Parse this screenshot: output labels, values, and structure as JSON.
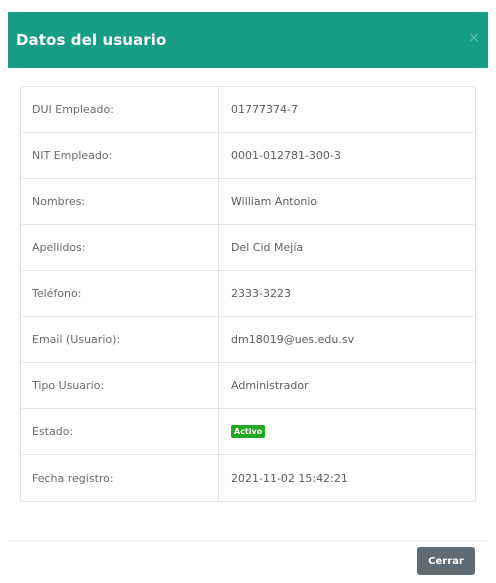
{
  "modal": {
    "title": "Datos del usuario",
    "close_icon": "×",
    "fields": [
      {
        "label": "DUI Empleado:",
        "value": "01777374-7"
      },
      {
        "label": "NIT Empleado:",
        "value": "0001-012781-300-3"
      },
      {
        "label": "Nombres:",
        "value": "William Antonio"
      },
      {
        "label": "Apellidos:",
        "value": "Del Cid Mejía"
      },
      {
        "label": "Teléfono:",
        "value": "2333-3223"
      },
      {
        "label": "Email (Usuario):",
        "value": "dm18019@ues.edu.sv"
      },
      {
        "label": "Tipo Usuario:",
        "value": "Administrador"
      },
      {
        "label": "Estado:",
        "value": "Activo"
      },
      {
        "label": "Fecha registro:",
        "value": "2021-11-02 15:42:21"
      }
    ],
    "close_button_label": "Cerrar",
    "colors": {
      "header": "#169d84",
      "status_badge": "#22a722",
      "close_button": "#5f6b75"
    }
  }
}
